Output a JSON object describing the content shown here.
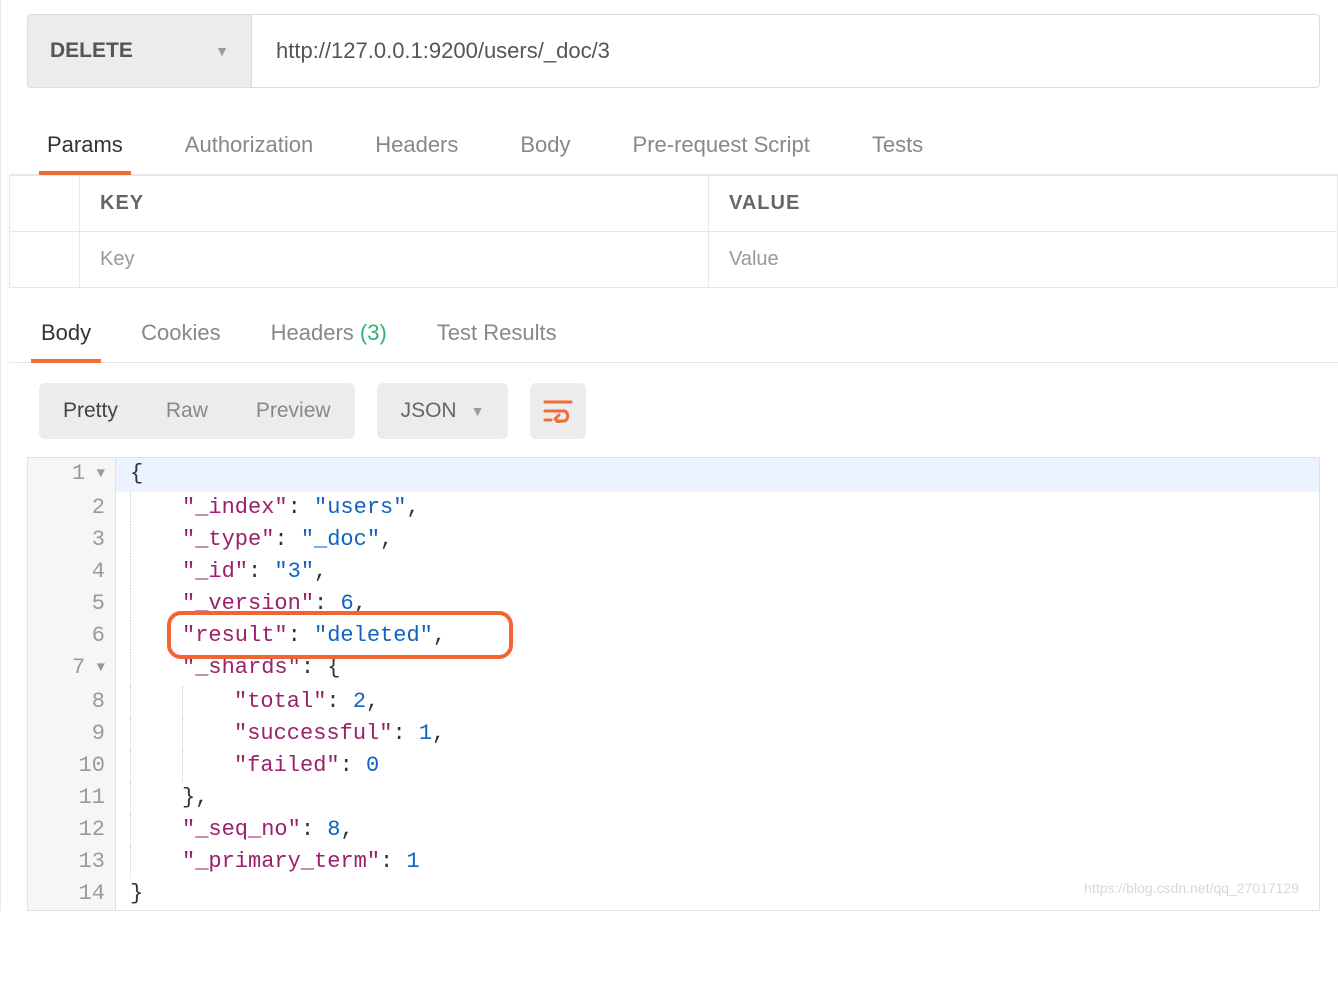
{
  "request": {
    "method": "DELETE",
    "url": "http://127.0.0.1:9200/users/_doc/3"
  },
  "request_tabs": {
    "items": [
      {
        "label": "Params",
        "active": true
      },
      {
        "label": "Authorization",
        "active": false
      },
      {
        "label": "Headers",
        "active": false
      },
      {
        "label": "Body",
        "active": false
      },
      {
        "label": "Pre-request Script",
        "active": false
      },
      {
        "label": "Tests",
        "active": false
      }
    ]
  },
  "params_table": {
    "header_key": "KEY",
    "header_value": "VALUE",
    "placeholder_key": "Key",
    "placeholder_value": "Value"
  },
  "response_tabs": {
    "items": [
      {
        "label": "Body",
        "active": true
      },
      {
        "label": "Cookies",
        "active": false
      },
      {
        "label": "Headers",
        "count": "(3)",
        "active": false
      },
      {
        "label": "Test Results",
        "active": false
      }
    ]
  },
  "view_modes": {
    "items": [
      {
        "label": "Pretty",
        "active": true
      },
      {
        "label": "Raw",
        "active": false
      },
      {
        "label": "Preview",
        "active": false
      }
    ],
    "format": "JSON"
  },
  "response_body": {
    "_index": "users",
    "_type": "_doc",
    "_id": "3",
    "_version": 6,
    "result": "deleted",
    "_shards": {
      "total": 2,
      "successful": 1,
      "failed": 0
    },
    "_seq_no": 8,
    "_primary_term": 1
  },
  "code_lines": [
    {
      "n": 1,
      "fold": true,
      "indent": 0,
      "tokens": [
        [
          "brace",
          "{"
        ]
      ]
    },
    {
      "n": 2,
      "fold": false,
      "indent": 1,
      "tokens": [
        [
          "key",
          "\"_index\""
        ],
        [
          "punc",
          ": "
        ],
        [
          "str",
          "\"users\""
        ],
        [
          "punc",
          ","
        ]
      ]
    },
    {
      "n": 3,
      "fold": false,
      "indent": 1,
      "tokens": [
        [
          "key",
          "\"_type\""
        ],
        [
          "punc",
          ": "
        ],
        [
          "str",
          "\"_doc\""
        ],
        [
          "punc",
          ","
        ]
      ]
    },
    {
      "n": 4,
      "fold": false,
      "indent": 1,
      "tokens": [
        [
          "key",
          "\"_id\""
        ],
        [
          "punc",
          ": "
        ],
        [
          "str",
          "\"3\""
        ],
        [
          "punc",
          ","
        ]
      ]
    },
    {
      "n": 5,
      "fold": false,
      "indent": 1,
      "tokens": [
        [
          "key",
          "\"_version\""
        ],
        [
          "punc",
          ": "
        ],
        [
          "num",
          "6"
        ],
        [
          "punc",
          ","
        ]
      ]
    },
    {
      "n": 6,
      "fold": false,
      "indent": 1,
      "tokens": [
        [
          "key",
          "\"result\""
        ],
        [
          "punc",
          ": "
        ],
        [
          "str",
          "\"deleted\""
        ],
        [
          "punc",
          ","
        ]
      ],
      "highlight": true
    },
    {
      "n": 7,
      "fold": true,
      "indent": 1,
      "tokens": [
        [
          "key",
          "\"_shards\""
        ],
        [
          "punc",
          ": "
        ],
        [
          "brace",
          "{"
        ]
      ]
    },
    {
      "n": 8,
      "fold": false,
      "indent": 2,
      "tokens": [
        [
          "key",
          "\"total\""
        ],
        [
          "punc",
          ": "
        ],
        [
          "num",
          "2"
        ],
        [
          "punc",
          ","
        ]
      ]
    },
    {
      "n": 9,
      "fold": false,
      "indent": 2,
      "tokens": [
        [
          "key",
          "\"successful\""
        ],
        [
          "punc",
          ": "
        ],
        [
          "num",
          "1"
        ],
        [
          "punc",
          ","
        ]
      ]
    },
    {
      "n": 10,
      "fold": false,
      "indent": 2,
      "tokens": [
        [
          "key",
          "\"failed\""
        ],
        [
          "punc",
          ": "
        ],
        [
          "num",
          "0"
        ]
      ]
    },
    {
      "n": 11,
      "fold": false,
      "indent": 1,
      "tokens": [
        [
          "brace",
          "}"
        ],
        [
          "punc",
          ","
        ]
      ]
    },
    {
      "n": 12,
      "fold": false,
      "indent": 1,
      "tokens": [
        [
          "key",
          "\"_seq_no\""
        ],
        [
          "punc",
          ": "
        ],
        [
          "num",
          "8"
        ],
        [
          "punc",
          ","
        ]
      ]
    },
    {
      "n": 13,
      "fold": false,
      "indent": 1,
      "tokens": [
        [
          "key",
          "\"_primary_term\""
        ],
        [
          "punc",
          ": "
        ],
        [
          "num",
          "1"
        ]
      ]
    },
    {
      "n": 14,
      "fold": false,
      "indent": 0,
      "tokens": [
        [
          "brace",
          "}"
        ]
      ]
    }
  ],
  "watermark": "https://blog.csdn.net/qq_27017129"
}
